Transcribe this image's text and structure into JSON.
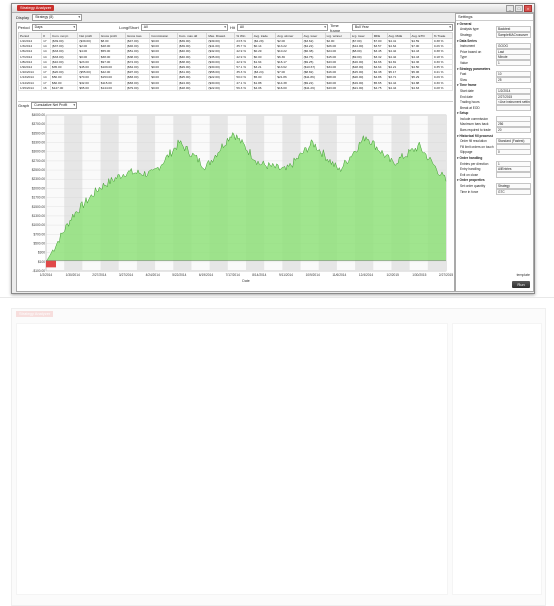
{
  "window": {
    "title": "Strategy Analyzer",
    "min": "_",
    "max": "□",
    "close": "×"
  },
  "toolbar": {
    "display_label": "Display",
    "display_value": "Strategy (8)"
  },
  "filters": {
    "period_label": "Period",
    "period_value": "Days",
    "long_short_label": "Long/Short",
    "long_short_value": "All",
    "hit_label": "Hit",
    "hit_value": "All",
    "time_label": "Time frame",
    "time_value": "Bull Year"
  },
  "table": {
    "headers": [
      "Period",
      "#",
      "Cum. net pr.",
      "Net profit",
      "Gross profit",
      "Gross loss",
      "Commission",
      "Cum. max dd",
      "Max. Drawd.",
      "% Win",
      "Avg. trade",
      "Avg. winner",
      "Avg. loser",
      "Lrg. winner",
      "Lrg. loser",
      "MFE",
      "Avg. MAE",
      "Avg. ETD",
      "% Trade"
    ],
    "rows": [
      [
        "1/2/2014",
        "17",
        "($39.00)",
        "($39.00)",
        "$8.00",
        "($47.00)",
        "$0.00",
        "($39.00)",
        "($39.00)",
        "23.5 %",
        "($2.29)",
        "$2.00",
        "($3.62)",
        "$2.00",
        "($7.00)",
        "$7.00",
        "$4.41",
        "$4.59",
        "0.38 %"
      ],
      [
        "1/3/2014",
        "14",
        "($37.00)",
        "$2.00",
        "$48.00",
        "($46.00)",
        "$0.00",
        "($39.00)",
        "($41.00)",
        "35.7 %",
        "$0.14",
        "$13.22",
        "($4.22)",
        "$26.00",
        "($14.00)",
        "$3.57",
        "$4.64",
        "$7.00",
        "0.26 %"
      ],
      [
        "1/6/2014",
        "14",
        "($33.00)",
        "$4.00",
        "$55.00",
        "($51.00)",
        "$0.00",
        "($40.00)",
        "($32.00)",
        "42.9 %",
        "$0.29",
        "$10.22",
        "($6.38)",
        "$24.00",
        "($8.00)",
        "$3.45",
        "$4.42",
        "$4.43",
        "0.38 %"
      ],
      [
        "1/7/2014",
        "14",
        "($33.00)",
        "$0.00",
        "$38.00",
        "($38.00)",
        "$0.00",
        "($40.00)",
        "($35.00)",
        "42.9 %",
        "$0.00",
        "$6.36",
        "($4.75)",
        "$15.00",
        "($9.00)",
        "$3.32",
        "$4.42",
        "$4.43",
        "0.18 %"
      ],
      [
        "1/8/2014",
        "14",
        "($10.00)",
        "$23.00",
        "$97.00",
        "($74.00)",
        "$0.00",
        "($38.00)",
        "($30.00)",
        "42.9 %",
        "$1.64",
        "$16.17",
        "($9.25)",
        "$43.00",
        "($16.00)",
        "$4.66",
        "$4.81",
        "$4.36",
        "0.30 %"
      ],
      [
        "1/9/2014",
        "14",
        "$35.00",
        "$45.00",
        "$109.00",
        "($64.00)",
        "$0.00",
        "($29.00)",
        "($30.00)",
        "57.1 %",
        "$3.21",
        "$13.62",
        "($10.67)",
        "$34.00",
        "($18.00)",
        "$4.64",
        "$4.21",
        "$4.50",
        "0.35 %"
      ],
      [
        "1/10/2014",
        "17",
        "($20.00)",
        "($55.00)",
        "$42.00",
        "($97.00)",
        "$0.00",
        "($31.00)",
        "($58.00)",
        "35.3 %",
        "($3.24)",
        "$7.00",
        "($8.82)",
        "$16.00",
        "($15.00)",
        "$2.38",
        "$5.17",
        "$5.06",
        "0.41 %"
      ],
      [
        "1/13/2014",
        "14",
        "$50.00",
        "$70.00",
        "$153.00",
        "($83.00)",
        "$0.00",
        "($25.00)",
        "($22.00)",
        "50.0 %",
        "$5.00",
        "$21.86",
        "($11.86)",
        "$68.00",
        "($20.00)",
        "$4.86",
        "$3.71",
        "$5.29",
        "0.29 %"
      ],
      [
        "1/14/2014",
        "17",
        "$82.00",
        "$32.00",
        "$115.00",
        "($83.00)",
        "$0.00",
        "($24.00)",
        "($30.00)",
        "47.1 %",
        "$1.88",
        "$14.38",
        "($9.22)",
        "$40.00",
        "($19.00)",
        "$5.65",
        "$4.44",
        "$4.88",
        "0.30 %"
      ],
      [
        "1/15/2014",
        "16",
        "$147.00",
        "$65.00",
        "$144.00",
        "($79.00)",
        "$0.00",
        "($18.00)",
        "($22.00)",
        "56.3 %",
        "$4.06",
        "$16.00",
        "($11.29)",
        "$43.00",
        "($21.00)",
        "$4.75",
        "$4.44",
        "$4.63",
        "0.28 %"
      ]
    ]
  },
  "graph": {
    "label": "Graph",
    "value": "Cumulative Net Profit"
  },
  "chart_data": {
    "type": "area",
    "x": [
      "1/2/2014",
      "1/30/2014",
      "2/27/2014",
      "3/27/2014",
      "4/24/2014",
      "5/22/2014",
      "6/19/2014",
      "7/17/2014",
      "8/14/2014",
      "9/11/2014",
      "10/9/2014",
      "11/6/2014",
      "12/4/2014",
      "1/2/2015",
      "1/30/2015",
      "2/27/2015"
    ],
    "x_tick_labels": [
      "1/2/2014",
      "1/30/2014",
      "2/27/2014",
      "3/27/2014",
      "4/24/2014",
      "5/22/2014",
      "6/19/2014",
      "7/17/2014",
      "8/14/2014",
      "9/11/2014",
      "10/9/2014",
      "11/6/2014",
      "12/4/2014",
      "1/2/2015",
      "1/30/2015",
      "2/27/2015"
    ],
    "values": [
      -39,
      1300,
      2100,
      2550,
      2500,
      3400,
      2700,
      3700,
      2800,
      2600,
      3400,
      2600,
      3600,
      2800,
      3300,
      2300
    ],
    "y_ticks": [
      "-$100.00",
      "$100",
      "$300",
      "$500.00",
      "$700.00",
      "$1000.00",
      "$1300.00",
      "$1500.00",
      "$1700.00",
      "$2000.00",
      "$2300.00",
      "$2500.00",
      "$2700.00",
      "$3000.00",
      "$3300.00",
      "$3500.00",
      "$3700.00",
      "$4000.00"
    ],
    "ylim": [
      -300,
      4200
    ],
    "xlabel": "Date",
    "ylabel": "Cumulative net profit ($)",
    "fill_color": "#8fe07a",
    "stroke_color": "#3c9b2c",
    "grid": true
  },
  "settings": {
    "title": "Settings",
    "rows": [
      {
        "k": "General",
        "v": "",
        "group": true
      },
      {
        "k": "Analysis type",
        "v": "Backtest"
      },
      {
        "k": "Strategy",
        "v": "SampleMACrossover"
      },
      {
        "k": "Data Series",
        "v": "",
        "group": true
      },
      {
        "k": "Instrument",
        "v": "GOOG"
      },
      {
        "k": "Price based on",
        "v": "Last"
      },
      {
        "k": "Type",
        "v": "Minute"
      },
      {
        "k": "Value",
        "v": "1"
      },
      {
        "k": "Strategy parameters",
        "v": "",
        "group": true
      },
      {
        "k": "Fast",
        "v": "10"
      },
      {
        "k": "Slow",
        "v": "25"
      },
      {
        "k": "Time frame",
        "v": "",
        "group": true
      },
      {
        "k": "Start date",
        "v": "1/2/2014"
      },
      {
        "k": "End date",
        "v": "2/27/2015"
      },
      {
        "k": "Trading hours",
        "v": "<Use instrument settings>"
      },
      {
        "k": "Break at EOD",
        "v": ""
      },
      {
        "k": "Setup",
        "v": "",
        "group": true
      },
      {
        "k": "Include commission",
        "v": ""
      },
      {
        "k": "Maximum bars back",
        "v": "256"
      },
      {
        "k": "Bars required to trade",
        "v": "20"
      },
      {
        "k": "Historical fill processing",
        "v": "",
        "group": true
      },
      {
        "k": "Order fill resolution",
        "v": "Standard (Fastest)"
      },
      {
        "k": "Fill limit orders on touch",
        "v": ""
      },
      {
        "k": "Slippage",
        "v": "0"
      },
      {
        "k": "Order handling",
        "v": "",
        "group": true
      },
      {
        "k": "Entries per direction",
        "v": "1"
      },
      {
        "k": "Entry handling",
        "v": "AllEntries"
      },
      {
        "k": "Exit on close",
        "v": ""
      },
      {
        "k": "Order properties",
        "v": "",
        "group": true
      },
      {
        "k": "Set order quantity",
        "v": "Strategy"
      },
      {
        "k": "Time in force",
        "v": "GTC"
      }
    ],
    "template_label": "template",
    "run_label": "Run"
  }
}
